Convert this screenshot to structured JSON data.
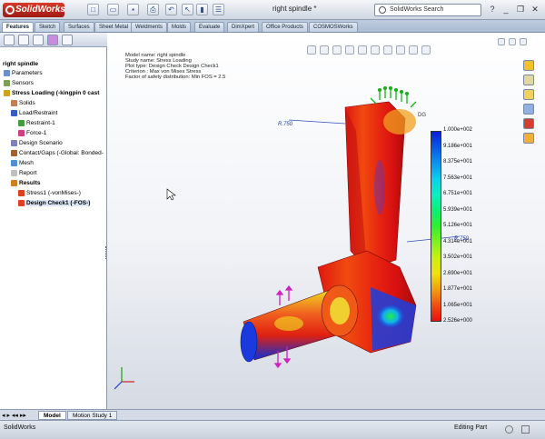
{
  "app": {
    "name": "SolidWorks",
    "document_title": "right spindle *"
  },
  "search": {
    "placeholder": "SolidWorks Search"
  },
  "command_tabs": [
    "Features",
    "Sketch",
    "Surfaces",
    "Sheet Metal",
    "Weldments",
    "Molds",
    "Evaluate",
    "DimXpert",
    "Office Products",
    "COSMOSWorks"
  ],
  "tree": {
    "root": "right spindle",
    "items": [
      {
        "label": "Parameters",
        "level": 0,
        "bold": false
      },
      {
        "label": "Sensors",
        "level": 0,
        "bold": false
      },
      {
        "label": "Stress Loading (-kingpin 0 cast",
        "level": 0,
        "bold": true
      },
      {
        "label": "Solids",
        "level": 1,
        "bold": false
      },
      {
        "label": "Load/Restraint",
        "level": 1,
        "bold": false
      },
      {
        "label": "Restraint-1",
        "level": 2,
        "bold": false
      },
      {
        "label": "Force-1",
        "level": 2,
        "bold": false
      },
      {
        "label": "Design Scenario",
        "level": 1,
        "bold": false
      },
      {
        "label": "Contact/Gaps (-Global: Bonded-",
        "level": 1,
        "bold": false
      },
      {
        "label": "Mesh",
        "level": 1,
        "bold": false
      },
      {
        "label": "Report",
        "level": 1,
        "bold": false
      },
      {
        "label": "Results",
        "level": 1,
        "bold": true
      },
      {
        "label": "Stress1 (-vonMises-)",
        "level": 2,
        "bold": false
      },
      {
        "label": "Design Check1 (-FOS-)",
        "level": 2,
        "bold": true,
        "selected": true
      }
    ]
  },
  "plot_info": [
    "Model name: right spindle",
    "Study name: Stress Loading",
    "Plot type: Design Check Design Check1",
    "Criterion : Max von Mises Stress",
    "Factor of safety distribution: Min FOS = 2.5"
  ],
  "annotations": {
    "dim_1": "R.750",
    "dim_2": "R.750",
    "label_dg": "DG"
  },
  "legend": {
    "labels": [
      "1.000e+002",
      "9.186e+001",
      "8.375e+001",
      "7.563e+001",
      "6.751e+001",
      "5.939e+001",
      "5.126e+001",
      "4.314e+001",
      "3.502e+001",
      "2.690e+001",
      "1.877e+001",
      "1.065e+001",
      "2.526e+000"
    ],
    "colors": [
      "#0a1fd6",
      "#0a59e8",
      "#0a95f0",
      "#0ad0f0",
      "#0af0c0",
      "#0af070",
      "#30f030",
      "#80f020",
      "#c8f010",
      "#f0e010",
      "#f0a010",
      "#f05010",
      "#e81010"
    ]
  },
  "model_tabs": [
    "Model",
    "Motion Study 1"
  ],
  "status": {
    "left": "SolidWorks",
    "mode": "Editing Part"
  },
  "colors": {
    "accent": "#c62a1c",
    "frame": "#b0bfd4"
  }
}
